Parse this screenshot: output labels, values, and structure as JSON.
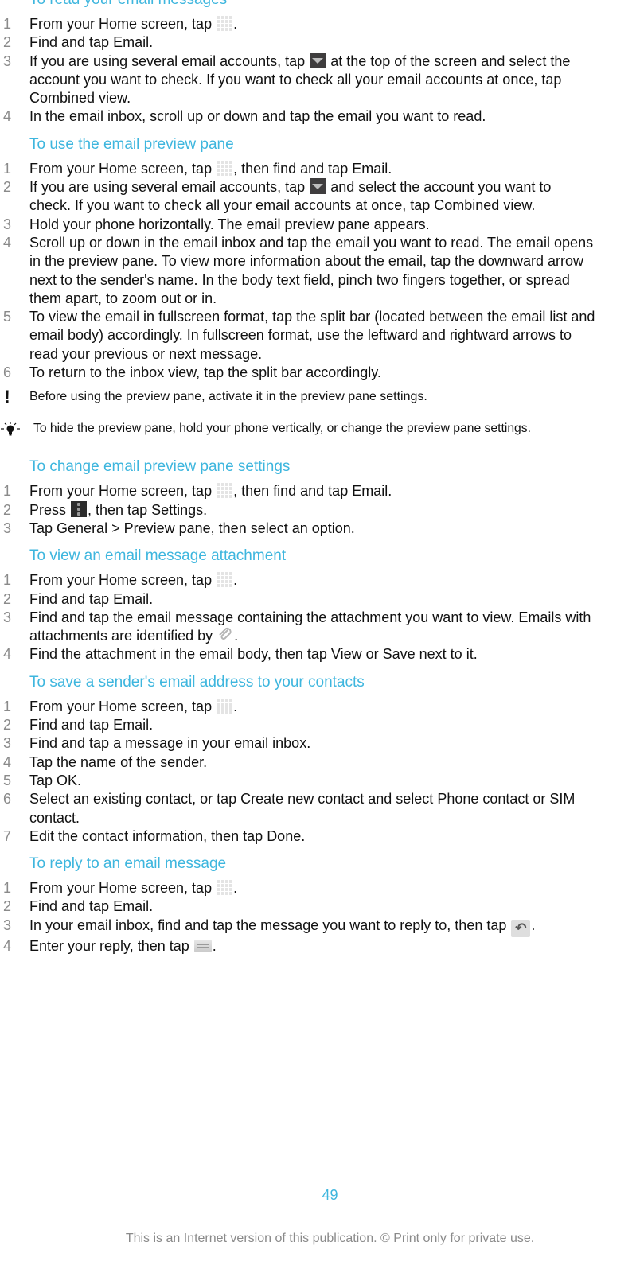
{
  "sections": [
    {
      "heading": "To read your email messages",
      "steps": [
        {
          "num": "1",
          "parts": [
            "From your Home screen, tap ",
            "."
          ]
        },
        {
          "num": "2",
          "parts": [
            "Find and tap ",
            "Email",
            "."
          ]
        },
        {
          "num": "3",
          "parts": [
            "If you are using several email accounts, tap ",
            " at the top of the screen and select the account you want to check. If you want to check all your email accounts at once, tap ",
            "Combined view",
            "."
          ]
        },
        {
          "num": "4",
          "parts": [
            "In the email inbox, scroll up or down and tap the email you want to read."
          ]
        }
      ]
    },
    {
      "heading": "To use the email preview pane",
      "steps": [
        {
          "num": "1",
          "parts": [
            "From your Home screen, tap ",
            ", then find and tap ",
            "Email",
            "."
          ]
        },
        {
          "num": "2",
          "parts": [
            "If you are using several email accounts, tap ",
            " and select the account you want to check. If you want to check all your email accounts at once, tap ",
            "Combined view",
            "."
          ]
        },
        {
          "num": "3",
          "parts": [
            "Hold your phone horizontally. The email preview pane appears."
          ]
        },
        {
          "num": "4",
          "parts": [
            "Scroll up or down in the email inbox and tap the email you want to read. The email opens in the preview pane. To view more information about the email, tap the downward arrow next to the sender's name. In the body text field, pinch two fingers together, or spread them apart, to zoom out or in."
          ]
        },
        {
          "num": "5",
          "parts": [
            "To view the email in fullscreen format, tap the split bar (located between the email list and email body) accordingly. In fullscreen format, use the leftward and rightward arrows to read your previous or next message."
          ]
        },
        {
          "num": "6",
          "parts": [
            "To return to the inbox view, tap the split bar accordingly."
          ]
        }
      ],
      "note_warning": "Before using the preview pane, activate it in the preview pane settings.",
      "note_tip": "To hide the preview pane, hold your phone vertically, or change the preview pane settings."
    },
    {
      "heading": "To change email preview pane settings",
      "steps": [
        {
          "num": "1",
          "parts": [
            "From your Home screen, tap ",
            ", then find and tap ",
            "Email",
            "."
          ]
        },
        {
          "num": "2",
          "parts": [
            "Press ",
            ", then tap ",
            "Settings",
            "."
          ]
        },
        {
          "num": "3",
          "parts": [
            "Tap ",
            "General",
            " > ",
            "Preview pane",
            ", then select an option."
          ]
        }
      ]
    },
    {
      "heading": "To view an email message attachment",
      "steps": [
        {
          "num": "1",
          "parts": [
            "From your Home screen, tap ",
            "."
          ]
        },
        {
          "num": "2",
          "parts": [
            "Find and tap ",
            "Email",
            "."
          ]
        },
        {
          "num": "3",
          "parts": [
            "Find and tap the email message containing the attachment you want to view. Emails with attachments are identified by ",
            "."
          ]
        },
        {
          "num": "4",
          "parts": [
            "Find the attachment in the email body, then tap ",
            "View",
            " or ",
            "Save",
            " next to it."
          ]
        }
      ]
    },
    {
      "heading": "To save a sender's email address to your contacts",
      "steps": [
        {
          "num": "1",
          "parts": [
            "From your Home screen, tap ",
            "."
          ]
        },
        {
          "num": "2",
          "parts": [
            "Find and tap ",
            "Email",
            "."
          ]
        },
        {
          "num": "3",
          "parts": [
            "Find and tap a message in your email inbox."
          ]
        },
        {
          "num": "4",
          "parts": [
            "Tap the name of the sender."
          ]
        },
        {
          "num": "5",
          "parts": [
            "Tap ",
            "OK",
            "."
          ]
        },
        {
          "num": "6",
          "parts": [
            "Select an existing contact, or tap ",
            "Create new contact",
            " and select ",
            "Phone contact",
            " or ",
            "SIM contact",
            "."
          ]
        },
        {
          "num": "7",
          "parts": [
            "Edit the contact information, then tap ",
            "Done",
            "."
          ]
        }
      ]
    },
    {
      "heading": "To reply to an email message",
      "steps": [
        {
          "num": "1",
          "parts": [
            "From your Home screen, tap ",
            "."
          ]
        },
        {
          "num": "2",
          "parts": [
            "Find and tap ",
            "Email",
            "."
          ]
        },
        {
          "num": "3",
          "parts": [
            "In your email inbox, find and tap the message you want to reply to, then tap ",
            "."
          ]
        },
        {
          "num": "4",
          "parts": [
            "Enter your reply, then tap ",
            "."
          ]
        }
      ]
    }
  ],
  "icons": {
    "apps": "apps-grid-icon",
    "dropdown": "dropdown-arrow-icon",
    "menu": "menu-icon",
    "attachment": "paperclip-icon",
    "reply": "reply-icon",
    "send": "send-icon",
    "reply_glyph": "↶",
    "clip_glyph": "📎"
  },
  "footer": {
    "page_number": "49",
    "notice": "This is an Internet version of this publication. © Print only for private use."
  },
  "colors": {
    "heading": "#3eb6de",
    "step_number": "#8a8a8a",
    "footer_text": "#8a8a8a"
  }
}
